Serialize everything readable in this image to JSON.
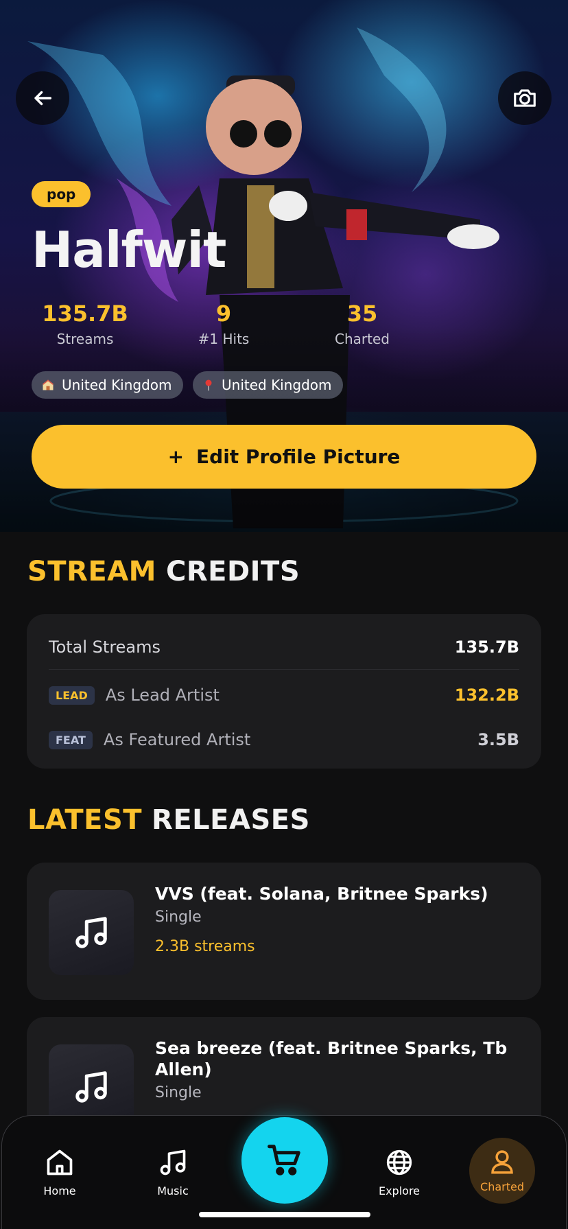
{
  "hero": {
    "genre": "pop",
    "artist_name": "Halfwit",
    "stats": [
      {
        "value": "135.7B",
        "label": "Streams"
      },
      {
        "value": "9",
        "label": "#1 Hits"
      },
      {
        "value": "35",
        "label": "Charted"
      }
    ],
    "locations": [
      {
        "icon": "house-icon",
        "text": "United Kingdom"
      },
      {
        "icon": "pin-icon",
        "text": "United Kingdom"
      }
    ],
    "edit_button": "Edit Profile Picture",
    "edit_button_plus": "+"
  },
  "credits": {
    "title_highlight": "STREAM",
    "title_rest": "CREDITS",
    "total_label": "Total Streams",
    "total_value": "135.7B",
    "lead_tag": "LEAD",
    "lead_label": "As Lead Artist",
    "lead_value": "132.2B",
    "feat_tag": "FEAT",
    "feat_label": "As Featured Artist",
    "feat_value": "3.5B"
  },
  "releases": {
    "title_highlight": "LATEST",
    "title_rest": "RELEASES",
    "items": [
      {
        "title": "VVS (feat. Solana, Britnee Sparks)",
        "type": "Single",
        "streams": "2.3B streams"
      },
      {
        "title": "Sea breeze (feat. Britnee Sparks, Tb Allen)",
        "type": "Single"
      }
    ]
  },
  "nav": {
    "items": [
      {
        "label": "Home",
        "icon": "home-icon"
      },
      {
        "label": "Music",
        "icon": "music-note-icon"
      },
      {
        "label": "",
        "icon": "cart-icon"
      },
      {
        "label": "Explore",
        "icon": "globe-icon"
      },
      {
        "label": "Charted",
        "icon": "user-icon"
      }
    ],
    "active": "Charted"
  },
  "colors": {
    "accent": "#fbc02d",
    "cart": "#14d4ee",
    "card": "#1c1c1e",
    "background": "#0f0f10",
    "active_nav": "#f6a23a"
  }
}
